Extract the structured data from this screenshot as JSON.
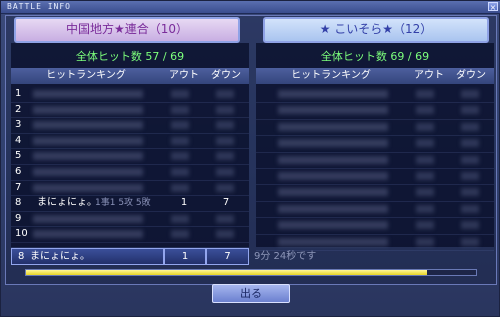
{
  "window": {
    "title": "BATTLE INFO",
    "close_label": "×"
  },
  "left_team": {
    "name": "中国地方★連合（10）",
    "hits": "全体ヒット数 57 / 69",
    "columns": {
      "rank": "ヒットランキング",
      "out": "アウト",
      "down": "ダウン"
    },
    "rows": [
      {
        "num": "1"
      },
      {
        "num": "2"
      },
      {
        "num": "3"
      },
      {
        "num": "4"
      },
      {
        "num": "5"
      },
      {
        "num": "6"
      },
      {
        "num": "7"
      },
      {
        "num": "8",
        "name": "まにょにょ。",
        "sub": "1事1 5攻 5敗",
        "out": "1",
        "down": "7"
      },
      {
        "num": "9"
      },
      {
        "num": "10"
      }
    ]
  },
  "right_team": {
    "name": "★ こいそら★（12）",
    "hits": "全体ヒット数 69 / 69",
    "columns": {
      "rank": "ヒットランキング",
      "out": "アウト",
      "down": "ダウン"
    },
    "timer": "9分 24秒です"
  },
  "selected": {
    "num": "8",
    "name": "まにょにょ。",
    "out": "1",
    "down": "7"
  },
  "progress": {
    "fraction": 0.89,
    "color": "#f0e040"
  },
  "exit_button": "出る",
  "colors": {
    "left_team": "#7a2c9a",
    "right_team": "#3340a8",
    "hits_text": "#7cff7c"
  }
}
